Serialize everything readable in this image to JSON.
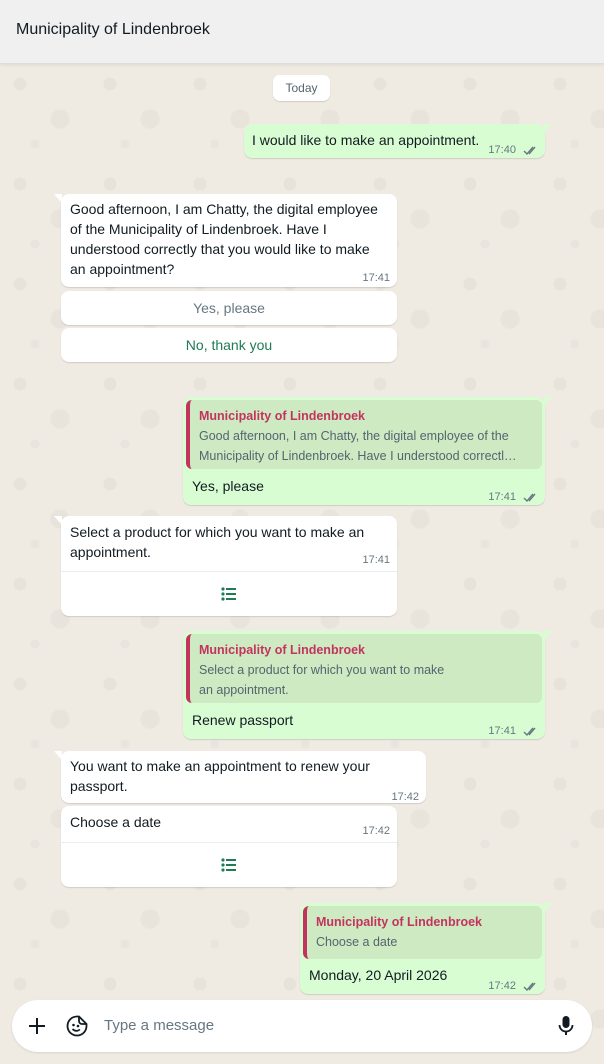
{
  "header": {
    "title": "Municipality of Lindenbroek"
  },
  "date_chip": "Today",
  "messages": {
    "m1": {
      "text": "I would like to make an appointment.",
      "time": "17:40"
    },
    "m2": {
      "text": "Good afternoon, I am Chatty, the digital employee\nof the Municipality of Lindenbroek. Have I\nunderstood correctly that you would like to make\nan appointment?",
      "time": "17:41",
      "options": [
        "Yes, please",
        "No, thank you"
      ]
    },
    "m3": {
      "quote_title": "Municipality of Lindenbroek",
      "quote_text": "Good afternoon, I am Chatty, the digital employee of the\nMunicipality of Lindenbroek. Have I understood correctl…",
      "text": "Yes, please",
      "time": "17:41"
    },
    "m4": {
      "text": "Select a product for which you want to make an\nappointment.",
      "time": "17:41"
    },
    "m5": {
      "quote_title": "Municipality of Lindenbroek",
      "quote_text": "Select a product for which you want to make\nan appointment.",
      "text": "Renew passport",
      "time": "17:41"
    },
    "m6": {
      "text": "You want to make an appointment to renew your\npassport.",
      "time": "17:42"
    },
    "m7": {
      "text": "Choose a date",
      "time": "17:42"
    },
    "m8": {
      "quote_title": "Municipality of Lindenbroek",
      "quote_text": "Choose a date",
      "text": "Monday, 20 April 2026",
      "time": "17:42"
    }
  },
  "composer": {
    "placeholder": "Type a message"
  },
  "colors": {
    "outgoing": "#d9fdd3",
    "incoming": "#ffffff",
    "accent_green": "#1f7a55",
    "quote_accent": "#c4335e",
    "tick_color": "#667781"
  },
  "icons": [
    "plus-icon",
    "sticker-icon",
    "microphone-icon",
    "double-check-icon",
    "list-icon"
  ]
}
